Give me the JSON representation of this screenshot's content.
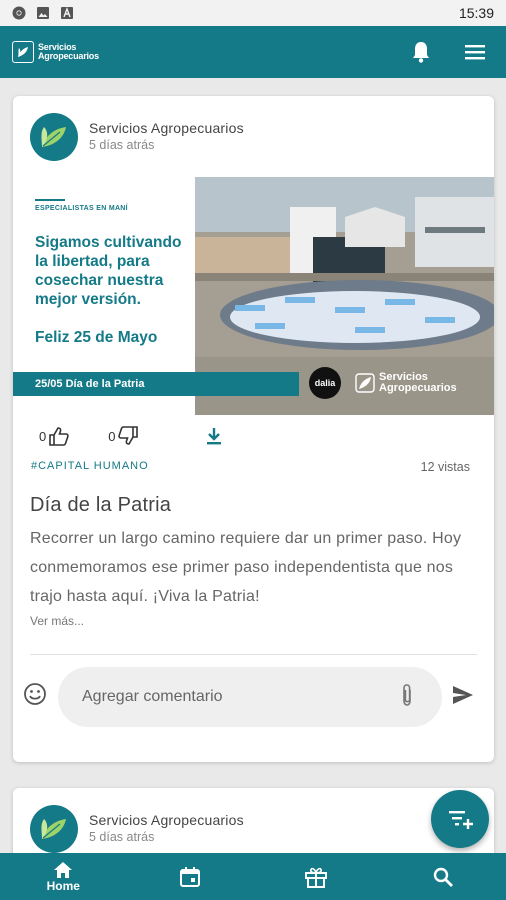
{
  "status": {
    "time": "15:39",
    "icons": [
      "chrome-icon",
      "image-icon",
      "font-icon"
    ]
  },
  "appbar": {
    "brand_line1": "Servicios",
    "brand_line2": "Agropecuarios",
    "icons": [
      "bell-icon",
      "menu-icon"
    ]
  },
  "post": {
    "author": "Servicios Agropecuarios",
    "ago": "5 días atrás",
    "banner": {
      "kicker": "ESPECIALISTAS EN MANÍ",
      "headline": "Sigamos cultivando la libertad, para cosechar nuestra mejor versión.",
      "greeting": "Feliz 25 de Mayo",
      "datebar": "25/05 Día de la Patria",
      "partner": "dalia",
      "brand_line1": "Servicios",
      "brand_line2": "Agropecuarios"
    },
    "likes": "0",
    "dislikes": "0",
    "tag": "#CAPITAL HUMANO",
    "views": "12 vistas",
    "title": "Día de la Patria",
    "body": "Recorrer un largo camino requiere dar un primer paso. Hoy conmemoramos ese primer paso independentista que nos trajo hasta aquí. ¡Viva la Patria!",
    "more": "Ver más...",
    "comment_placeholder": "Agregar comentario"
  },
  "post2": {
    "author": "Servicios Agropecuarios",
    "ago": "5 días atrás"
  },
  "nav": {
    "home_label": "Home"
  },
  "colors": {
    "primary": "#157a87",
    "background": "#e9e9e9"
  }
}
